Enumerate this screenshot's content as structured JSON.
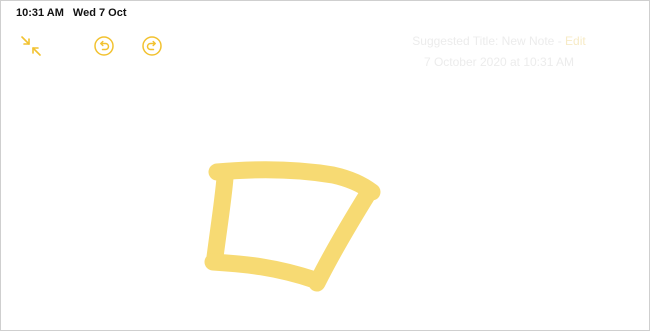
{
  "status_bar": {
    "time": "10:31 AM",
    "date": "Wed 7 Oct"
  },
  "toolbar": {
    "collapse_icon": "collapse-arrows-icon",
    "undo_icon": "undo-icon",
    "redo_icon": "redo-icon",
    "accent_color": "#f2c230"
  },
  "note": {
    "suggested_title_label": "Suggested Title: New Note",
    "edit_label": "Edit",
    "timestamp": "7 October 2020 at 10:31 AM"
  },
  "drawing": {
    "tool": "highlighter",
    "stroke_color": "#f7d764",
    "shape": "quadrilateral"
  }
}
